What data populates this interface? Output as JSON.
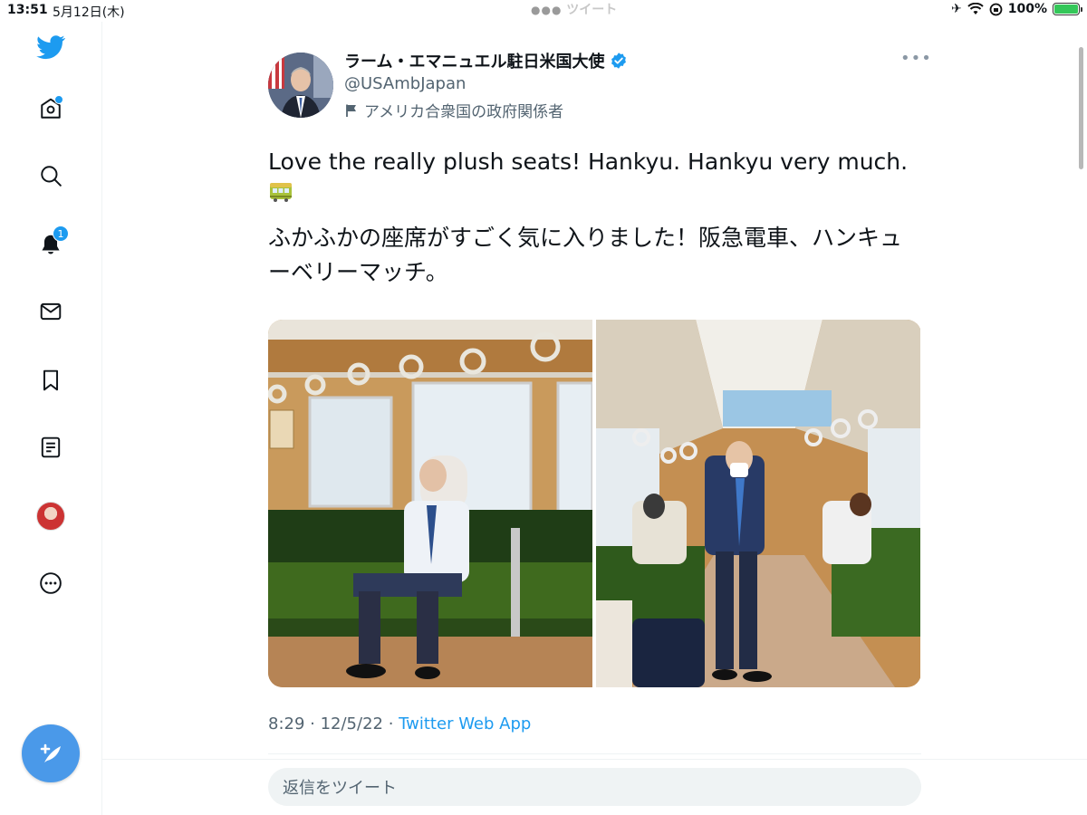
{
  "status_bar": {
    "time": "13:51",
    "date": "5月12日(木)",
    "center_title": "ツイート",
    "battery": "100%",
    "battery_level": 1.0
  },
  "nav": {
    "notifications_badge": "1"
  },
  "tweet": {
    "author_name": "ラーム・エマニュエル駐日米国大使",
    "handle": "@USAmbJapan",
    "gov_label": "アメリカ合衆国の政府関係者",
    "text_en": "Love the really plush seats! Hankyu. Hankyu very much.",
    "emoji": "🚃",
    "text_ja": "ふかふかの座席がすごく気に入りました！阪急電車、ハンキューベリーマッチ。",
    "timestamp": "8:29 · 12/5/22 · ",
    "source_app": "Twitter Web App"
  },
  "reply": {
    "placeholder": "返信をツイート"
  },
  "colors": {
    "accent": "#1d9bf0",
    "compose_button": "#4a99e9",
    "muted_text": "#536471",
    "seat_green": "#3f6a1e"
  }
}
